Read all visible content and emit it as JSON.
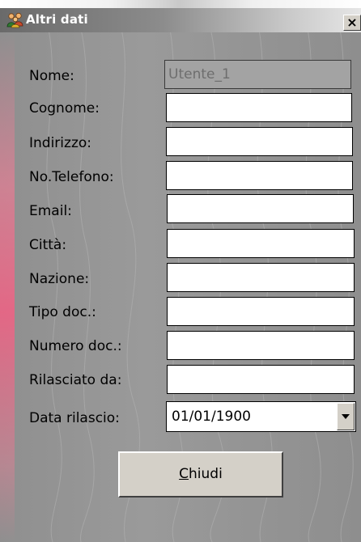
{
  "window": {
    "title": "Altri dati",
    "close_glyph": "×"
  },
  "form": {
    "fields": [
      {
        "label": "Nome:",
        "value": "Utente_1",
        "readonly": true
      },
      {
        "label": "Cognome:",
        "value": ""
      },
      {
        "label": "Indirizzo:",
        "value": ""
      },
      {
        "label": "No.Telefono:",
        "value": ""
      },
      {
        "label": "Email:",
        "value": ""
      },
      {
        "label": "Città:",
        "value": ""
      },
      {
        "label": "Nazione:",
        "value": ""
      },
      {
        "label": "Tipo doc.:",
        "value": ""
      },
      {
        "label": "Numero doc.:",
        "value": ""
      },
      {
        "label": "Rilasciato da:",
        "value": ""
      }
    ],
    "date": {
      "label": "Data rilascio:",
      "value": "01/01/1900"
    }
  },
  "buttons": {
    "close_access_key": "C",
    "close_rest": "hiudi"
  },
  "icons": {
    "title_icon": "users-icon",
    "close_icon": "close-icon",
    "dropdown_icon": "chevron-down-icon"
  }
}
